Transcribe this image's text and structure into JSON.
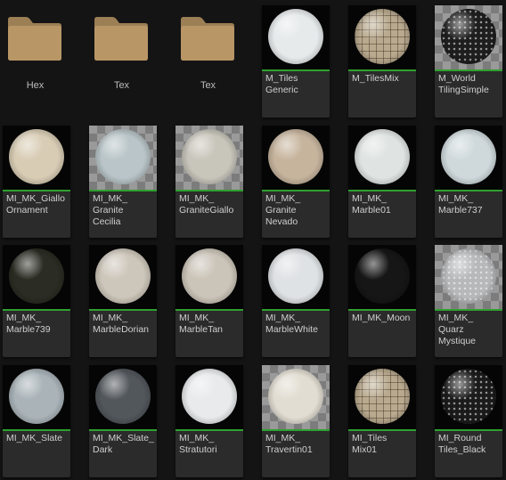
{
  "folders": [
    {
      "label": "Hex",
      "icon": "folder-icon"
    },
    {
      "label": "Tex",
      "icon": "folder-icon"
    },
    {
      "label": "Tex",
      "icon": "folder-icon"
    }
  ],
  "accent_color": "#2fa12f",
  "assets": [
    {
      "label": "M_Tiles\nGeneric",
      "color": "#e6eaeb",
      "pattern": "plain",
      "bg": "dark"
    },
    {
      "label": "M_TilesMix",
      "color": "#b9aa8f",
      "pattern": "tiles",
      "bg": "dark"
    },
    {
      "label": "M_World\nTilingSimple",
      "color": "#1e1e1e",
      "pattern": "dots",
      "bg": "checker"
    },
    {
      "label": "MI_MK_Giallo\nOrnament",
      "color": "#d8ccb4",
      "pattern": "plain",
      "bg": "dark"
    },
    {
      "label": "MI_MK_\nGranite\nCecilia",
      "color": "#b9c5c8",
      "pattern": "plain",
      "bg": "checker"
    },
    {
      "label": "MI_MK_\nGraniteGiallo",
      "color": "#c8c6bb",
      "pattern": "plain",
      "bg": "checker"
    },
    {
      "label": "MI_MK_\nGranite\nNevado",
      "color": "#c6b49d",
      "pattern": "plain",
      "bg": "dark"
    },
    {
      "label": "MI_MK_\nMarble01",
      "color": "#dfe4e2",
      "pattern": "plain",
      "bg": "dark"
    },
    {
      "label": "MI_MK_\nMarble737",
      "color": "#cfd9dc",
      "pattern": "plain",
      "bg": "dark"
    },
    {
      "label": "MI_MK_\nMarble739",
      "color": "#2b2d24",
      "pattern": "plain",
      "bg": "dark"
    },
    {
      "label": "MI_MK_\nMarbleDorian",
      "color": "#cdc6ba",
      "pattern": "plain",
      "bg": "dark"
    },
    {
      "label": "MI_MK_\nMarbleTan",
      "color": "#cbc4b8",
      "pattern": "plain",
      "bg": "dark"
    },
    {
      "label": "MI_MK_\nMarbleWhite",
      "color": "#dfe2e4",
      "pattern": "plain",
      "bg": "dark"
    },
    {
      "label": "MI_MK_Moon",
      "color": "#161616",
      "pattern": "plain",
      "bg": "dark"
    },
    {
      "label": "MI_MK_\nQuarz\nMystique",
      "color": "#b6b8ba",
      "pattern": "dots",
      "bg": "checker"
    },
    {
      "label": "MI_MK_Slate",
      "color": "#a9b3b8",
      "pattern": "plain",
      "bg": "dark"
    },
    {
      "label": "MI_MK_Slate_\nDark",
      "color": "#52575c",
      "pattern": "plain",
      "bg": "dark"
    },
    {
      "label": "MI_MK_\nStratutori",
      "color": "#e8eaeb",
      "pattern": "plain",
      "bg": "dark"
    },
    {
      "label": "MI_MK_\nTravertin01",
      "color": "#e2ddd2",
      "pattern": "plain",
      "bg": "checker"
    },
    {
      "label": "MI_Tiles\nMix01",
      "color": "#b9aa8f",
      "pattern": "tiles",
      "bg": "dark"
    },
    {
      "label": "MI_Round\nTiles_Black",
      "color": "#1b1b1b",
      "pattern": "dots",
      "bg": "dark"
    }
  ]
}
